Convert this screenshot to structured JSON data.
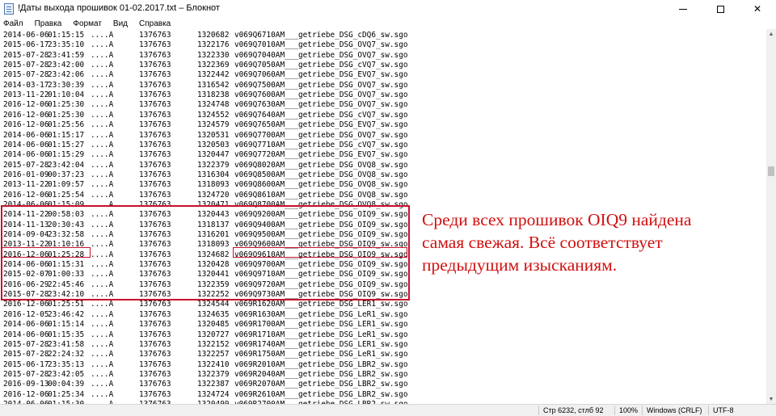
{
  "window": {
    "title": "!Даты выхода прошивок 01-02.2017.txt – Блокнот",
    "minimize_icon": "minimize-icon",
    "maximize_icon": "maximize-icon",
    "close_glyph": "✕"
  },
  "menu": {
    "items": [
      "Файл",
      "Правка",
      "Формат",
      "Вид",
      "Справка"
    ]
  },
  "editor": {
    "lines": [
      [
        "2014-06-06",
        "01:15:15",
        "....A",
        "1376763",
        "1320682",
        "v069Q6710AM___getriebe_DSG_cDQ6_sw.sgo"
      ],
      [
        "2015-06-17",
        "23:35:10",
        "....A",
        "1376763",
        "1322176",
        "v069Q7010AM___getriebe_DSG_OVQ7_sw.sgo"
      ],
      [
        "2015-07-28",
        "23:41:59",
        "....A",
        "1376763",
        "1322330",
        "v069Q7040AM___getriebe_DSG_OVQ7_sw.sgo"
      ],
      [
        "2015-07-28",
        "23:42:00",
        "....A",
        "1376763",
        "1322369",
        "v069Q7050AM___getriebe_DSG_cVQ7_sw.sgo"
      ],
      [
        "2015-07-28",
        "23:42:06",
        "....A",
        "1376763",
        "1322442",
        "v069Q7060AM___getriebe_DSG_EVQ7_sw.sgo"
      ],
      [
        "2014-03-17",
        "23:30:39",
        "....A",
        "1376763",
        "1316542",
        "v069Q7500AM___getriebe_DSG_OVQ7_sw.sgo"
      ],
      [
        "2013-11-22",
        "01:10:04",
        "....A",
        "1376763",
        "1318238",
        "v069Q7600AM___getriebe_DSG_OVQ7_sw.sgo"
      ],
      [
        "2016-12-06",
        "01:25:30",
        "....A",
        "1376763",
        "1324748",
        "v069Q7630AM___getriebe_DSG_OVQ7_sw.sgo"
      ],
      [
        "2016-12-06",
        "01:25:30",
        "....A",
        "1376763",
        "1324552",
        "v069Q7640AM___getriebe_DSG_cVQ7_sw.sgo"
      ],
      [
        "2016-12-06",
        "01:25:56",
        "....A",
        "1376763",
        "1324579",
        "v069Q7650AM___getriebe_DSG_EVQ7_sw.sgo"
      ],
      [
        "2014-06-06",
        "01:15:17",
        "....A",
        "1376763",
        "1320531",
        "v069Q7700AM___getriebe_DSG_OVQ7_sw.sgo"
      ],
      [
        "2014-06-06",
        "01:15:27",
        "....A",
        "1376763",
        "1320503",
        "v069Q7710AM___getriebe_DSG_cVQ7_sw.sgo"
      ],
      [
        "2014-06-06",
        "01:15:29",
        "....A",
        "1376763",
        "1320447",
        "v069Q7720AM___getriebe_DSG_EVQ7_sw.sgo"
      ],
      [
        "2015-07-28",
        "23:42:04",
        "....A",
        "1376763",
        "1322379",
        "v069Q8020AM___getriebe_DSG_OVQ8_sw.sgo"
      ],
      [
        "2016-01-09",
        "00:37:23",
        "....A",
        "1376763",
        "1316304",
        "v069Q8500AM___getriebe_DSG_OVQ8_sw.sgo"
      ],
      [
        "2013-11-22",
        "01:09:57",
        "....A",
        "1376763",
        "1318093",
        "v069Q8600AM___getriebe_DSG_OVQ8_sw.sgo"
      ],
      [
        "2016-12-06",
        "01:25:54",
        "....A",
        "1376763",
        "1324720",
        "v069Q8610AM___getriebe_DSG_OVQ8_sw.sgo"
      ],
      [
        "2014-06-06",
        "01:15:09",
        "....A",
        "1376763",
        "1320471",
        "v069Q8700AM___getriebe_DSG_OVQ8_sw.sgo"
      ],
      [
        "2014-11-22",
        "00:58:03",
        "....A",
        "1376763",
        "1320443",
        "v069Q9200AM___getriebe_DSG_OIQ9_sw.sgo"
      ],
      [
        "2014-11-13",
        "20:30:43",
        "....A",
        "1376763",
        "1318137",
        "v069Q9400AM___getriebe_DSG_OIQ9_sw.sgo"
      ],
      [
        "2014-09-04",
        "23:32:58",
        "....A",
        "1376763",
        "1316201",
        "v069Q9500AM___getriebe_DSG_OIQ9_sw.sgo"
      ],
      [
        "2013-11-22",
        "01:10:16",
        "....A",
        "1376763",
        "1318093",
        "v069Q9600AM___getriebe_DSG_OIQ9_sw.sgo"
      ],
      [
        "2016-12-06",
        "01:25:28",
        "....A",
        "1376763",
        "1324682",
        "v069Q9610AM___getriebe_DSG_OIQ9_sw.sgo"
      ],
      [
        "2014-06-06",
        "01:15:31",
        "....A",
        "1376763",
        "1320428",
        "v069Q9700AM___getriebe_DSG_OIQ9_sw.sgo"
      ],
      [
        "2015-02-07",
        "01:00:33",
        "....A",
        "1376763",
        "1320441",
        "v069Q9710AM___getriebe_DSG_OIQ9_sw.sgo"
      ],
      [
        "2016-06-29",
        "22:45:46",
        "....A",
        "1376763",
        "1322359",
        "v069Q9720AM___getriebe_DSG_OIQ9_sw.sgo"
      ],
      [
        "2015-07-28",
        "23:42:10",
        "....A",
        "1376763",
        "1322252",
        "v069Q9730AM___getriebe_DSG_OIQ9_sw.sgo"
      ],
      [
        "2016-12-06",
        "01:25:51",
        "....A",
        "1376763",
        "1324544",
        "v069R1620AM___getriebe_DSG_LER1_sw.sgo"
      ],
      [
        "2016-12-05",
        "23:46:42",
        "....A",
        "1376763",
        "1324635",
        "v069R1630AM___getriebe_DSG_LeR1_sw.sgo"
      ],
      [
        "2014-06-06",
        "01:15:14",
        "....A",
        "1376763",
        "1320485",
        "v069R1700AM___getriebe_DSG_LER1_sw.sgo"
      ],
      [
        "2014-06-06",
        "01:15:35",
        "....A",
        "1376763",
        "1320727",
        "v069R1710AM___getriebe_DSG_LeR1_sw.sgo"
      ],
      [
        "2015-07-28",
        "23:41:58",
        "....A",
        "1376763",
        "1322152",
        "v069R1740AM___getriebe_DSG_LER1_sw.sgo"
      ],
      [
        "2015-07-28",
        "22:24:32",
        "....A",
        "1376763",
        "1322257",
        "v069R1750AM___getriebe_DSG_LeR1_sw.sgo"
      ],
      [
        "2015-06-17",
        "23:35:13",
        "....A",
        "1376763",
        "1322410",
        "v069R2010AM___getriebe_DSG_LBR2_sw.sgo"
      ],
      [
        "2015-07-28",
        "23:42:05",
        "....A",
        "1376763",
        "1322379",
        "v069R2040AM___getriebe_DSG_LBR2_sw.sgo"
      ],
      [
        "2016-09-13",
        "00:04:39",
        "....A",
        "1376763",
        "1322387",
        "v069R2070AM___getriebe_DSG_LBR2_sw.sgo"
      ],
      [
        "2016-12-06",
        "01:25:34",
        "....A",
        "1376763",
        "1324724",
        "v069R2610AM___getriebe_DSG_LBR2_sw.sgo"
      ],
      [
        "2014-06-06",
        "01:15:30",
        "....A",
        "1376763",
        "1320499",
        "v069R2700AM___getriebe_DSG_LBR2_sw.sgo"
      ]
    ]
  },
  "annotation": {
    "lines": [
      "Среди всех прошивок OIQ9 найдена",
      "самая свежая. Всё соответствует",
      "предыдущим изысканиям."
    ],
    "color": "#d01010"
  },
  "statusbar": {
    "position": "Стр 6232, стлб 92",
    "zoom": "100%",
    "line_endings": "Windows (CRLF)",
    "encoding": "UTF-8"
  },
  "colors": {
    "highlight_border": "#c8102e"
  }
}
